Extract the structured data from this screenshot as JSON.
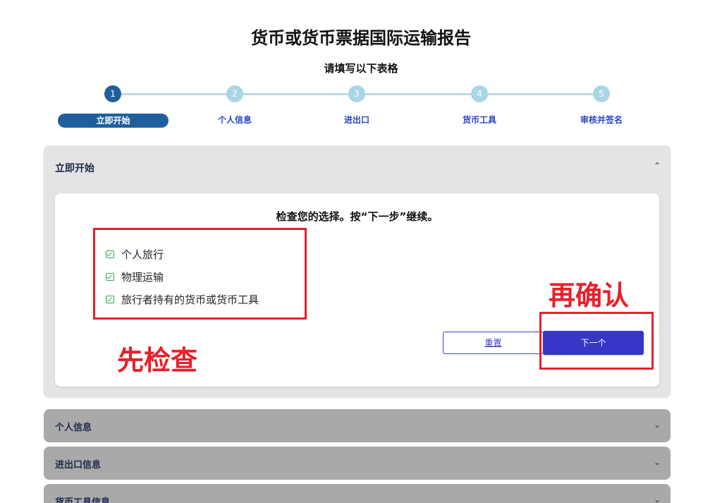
{
  "header": {
    "title": "货币或货币票据国际运输报告",
    "subtitle": "请填写以下表格"
  },
  "stepper": {
    "steps": [
      {
        "number": "1",
        "label": "立即开始",
        "active": true
      },
      {
        "number": "2",
        "label": "个人信息",
        "active": false
      },
      {
        "number": "3",
        "label": "进出口",
        "active": false
      },
      {
        "number": "4",
        "label": "货币工具",
        "active": false
      },
      {
        "number": "5",
        "label": "审核并签名",
        "active": false
      }
    ]
  },
  "main_panel": {
    "title": "立即开始",
    "chevron_icon": "chevron-up-icon",
    "card": {
      "heading": "检查您的选择。按“下一步”继续。",
      "items": [
        "个人旅行",
        "物理运输",
        "旅行者持有的货币或货币工具"
      ],
      "reset_label": "重置",
      "next_label": "下一个"
    }
  },
  "annotations": {
    "check_first": "先检查",
    "confirm_again": "再确认",
    "color": "#e8202a"
  },
  "collapsed_panels": [
    {
      "title": "个人信息",
      "chevron_icon": "chevron-down-icon"
    },
    {
      "title": "进出口信息",
      "chevron_icon": "chevron-down-icon"
    },
    {
      "title": "货币工具信息",
      "chevron_icon": "chevron-down-icon"
    }
  ],
  "colors": {
    "step_active": "#1f5f9e",
    "step_inactive": "#a9d6e6",
    "step_label": "#2a46c4",
    "primary_button": "#3636c8",
    "check_green": "#34a853",
    "collapsed_panel": "#a9a9a9"
  }
}
